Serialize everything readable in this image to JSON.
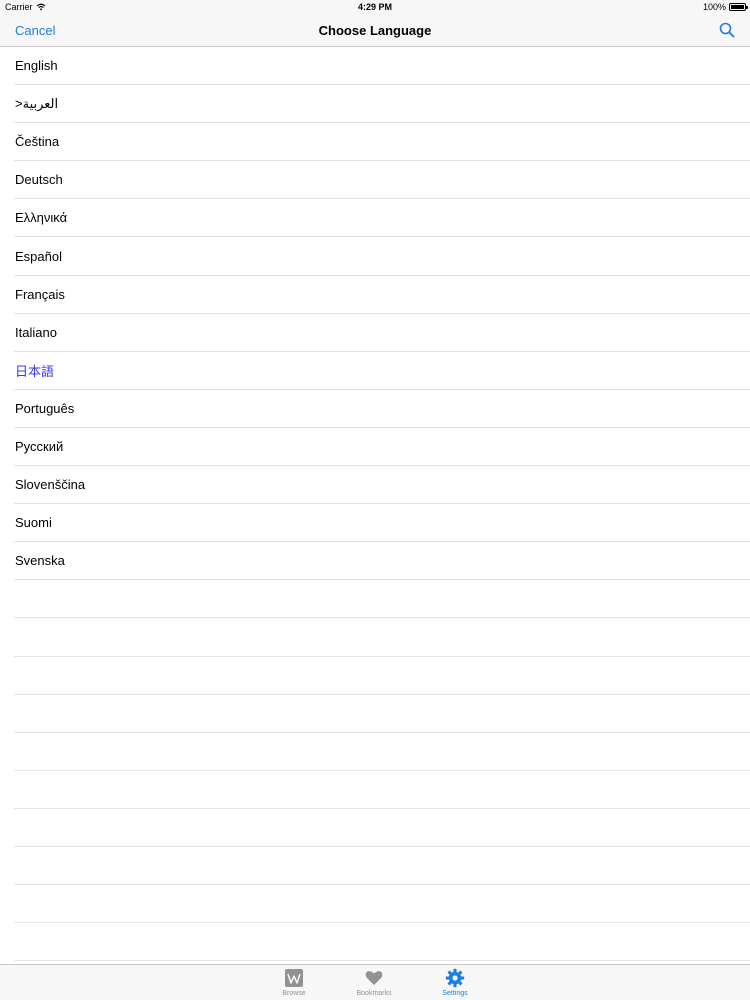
{
  "status_bar": {
    "carrier": "Carrier",
    "time": "4:29 PM",
    "battery": "100%",
    "icons": [
      "wifi-icon",
      "battery-icon"
    ]
  },
  "nav": {
    "cancel_label": "Cancel",
    "title": "Choose Language",
    "search_icon": "search-icon"
  },
  "languages": [
    {
      "label": "English",
      "selected": false
    },
    {
      "label": ">العربية",
      "selected": false
    },
    {
      "label": "Čeština",
      "selected": false
    },
    {
      "label": "Deutsch",
      "selected": false
    },
    {
      "label": "Ελληνικά",
      "selected": false
    },
    {
      "label": "Español",
      "selected": false
    },
    {
      "label": "Français",
      "selected": false
    },
    {
      "label": "Italiano",
      "selected": false
    },
    {
      "label": "日本語",
      "selected": true
    },
    {
      "label": "Português",
      "selected": false
    },
    {
      "label": "Русский",
      "selected": false
    },
    {
      "label": "Slovenščina",
      "selected": false
    },
    {
      "label": "Suomi",
      "selected": false
    },
    {
      "label": "Svenska",
      "selected": false
    }
  ],
  "tabs": [
    {
      "label": "Browse",
      "icon": "wikipedia-icon",
      "active": false
    },
    {
      "label": "Bookmarks",
      "icon": "heart-icon",
      "active": false
    },
    {
      "label": "Settings",
      "icon": "gear-icon",
      "active": true
    }
  ],
  "colors": {
    "accent": "#1a7ee6",
    "selected_text": "#3a3aff",
    "bar_background": "#f7f7f7",
    "separator": "#e2e2e6"
  }
}
